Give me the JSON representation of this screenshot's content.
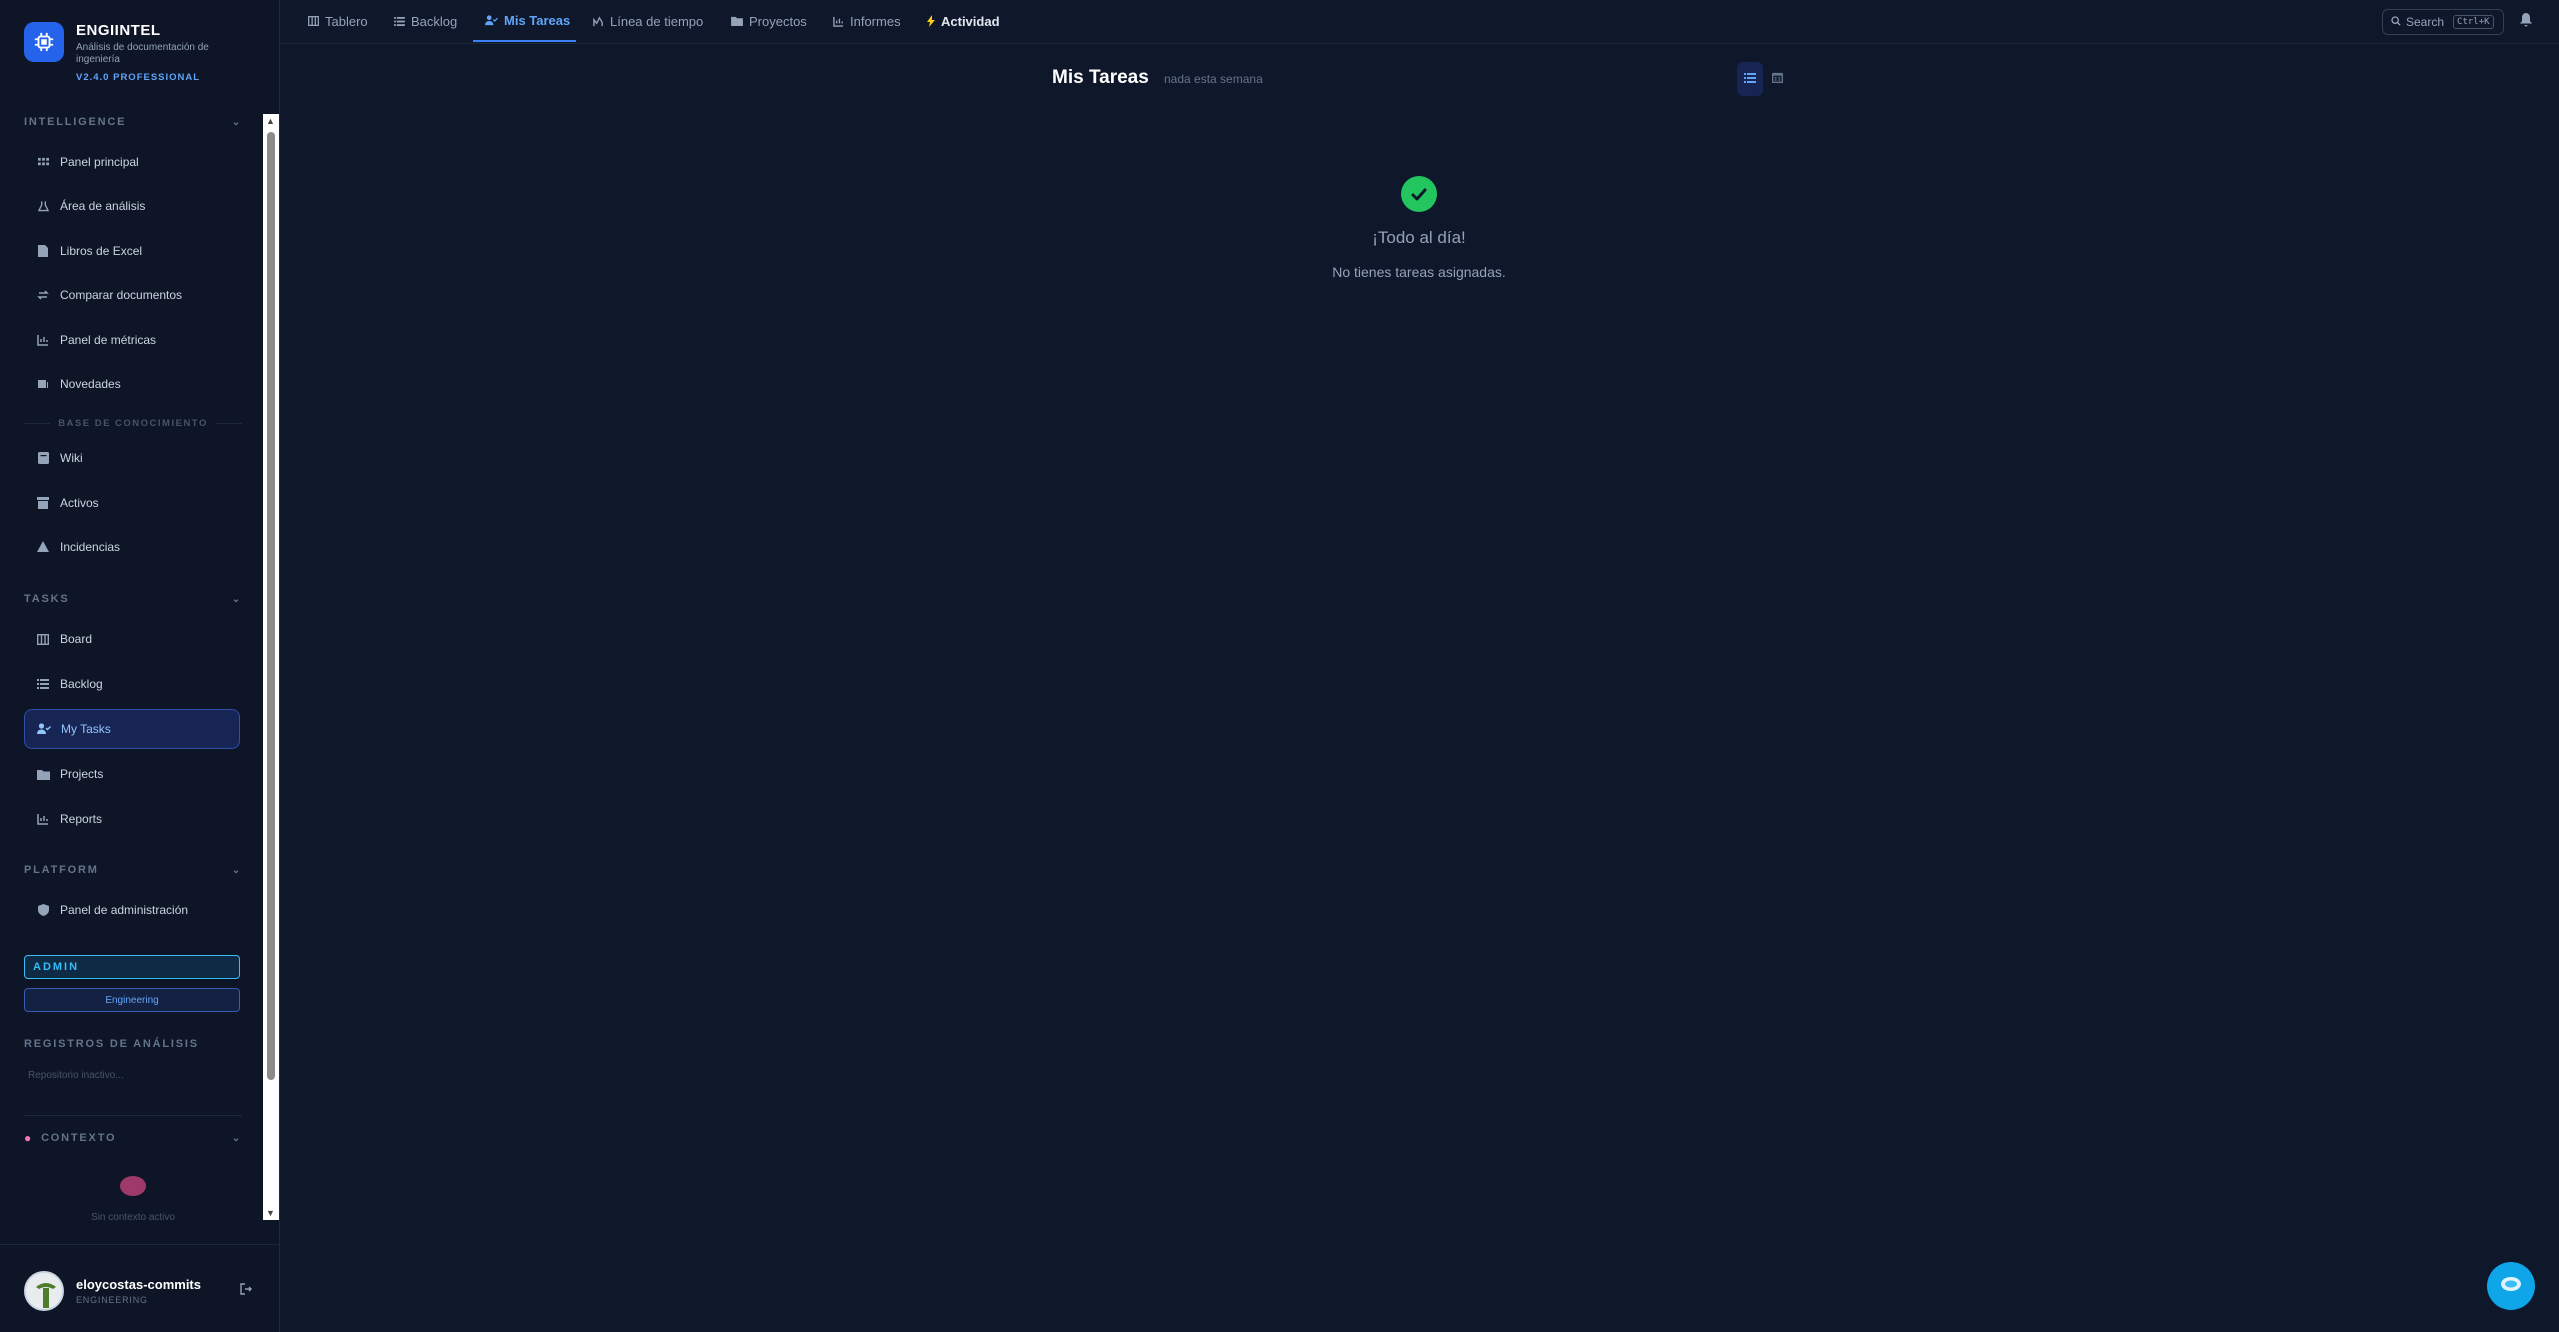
{
  "brand": {
    "title": "ENGIINTEL",
    "subtitle": "Análisis de documentación de ingeniería",
    "version": "V2.4.0 PROFESSIONAL"
  },
  "sidebar": {
    "intelligence_label": "INTELLIGENCE",
    "intelligence_items": [
      {
        "label": "Panel principal",
        "icon": "grid-icon"
      },
      {
        "label": "Área de análisis",
        "icon": "flask-icon"
      },
      {
        "label": "Libros de Excel",
        "icon": "file-icon"
      },
      {
        "label": "Comparar documentos",
        "icon": "compare-icon"
      },
      {
        "label": "Panel de métricas",
        "icon": "chart-icon"
      },
      {
        "label": "Novedades",
        "icon": "news-icon"
      }
    ],
    "knowledge_label": "BASE DE CONOCIMIENTO",
    "knowledge_items": [
      {
        "label": "Wiki",
        "icon": "book-icon"
      },
      {
        "label": "Activos",
        "icon": "archive-icon"
      },
      {
        "label": "Incidencias",
        "icon": "warning-icon"
      }
    ],
    "tasks_label": "TASKS",
    "tasks_items": [
      {
        "label": "Board",
        "icon": "board-icon"
      },
      {
        "label": "Backlog",
        "icon": "list-icon"
      },
      {
        "label": "My Tasks",
        "icon": "user-check-icon",
        "active": true
      },
      {
        "label": "Projects",
        "icon": "folder-icon"
      },
      {
        "label": "Reports",
        "icon": "chart-icon"
      }
    ],
    "platform_label": "PLATFORM",
    "platform_items": [
      {
        "label": "Panel de administración",
        "icon": "shield-icon"
      }
    ],
    "role_badge": "ADMIN",
    "team_badge": "Engineering",
    "logs_label": "REGISTROS DE ANÁLISIS",
    "logs_empty": "Repositorio inactivo...",
    "context_label": "CONTEXTO",
    "context_empty": "Sin contexto activo"
  },
  "user": {
    "name": "eloycostas-commits",
    "role": "ENGINEERING"
  },
  "topnav": {
    "tabs": [
      {
        "label": "Tablero",
        "icon": "board-icon"
      },
      {
        "label": "Backlog",
        "icon": "list-icon"
      },
      {
        "label": "Mis Tareas",
        "icon": "user-check-icon",
        "active": true
      },
      {
        "label": "Línea de tiempo",
        "icon": "timeline-icon"
      },
      {
        "label": "Proyectos",
        "icon": "folder-icon"
      },
      {
        "label": "Informes",
        "icon": "chart-icon"
      },
      {
        "label": "Actividad",
        "icon": "bolt-icon"
      }
    ],
    "search_label": "Search",
    "search_shortcut": "Ctrl+K"
  },
  "main": {
    "title": "Mis Tareas",
    "subtitle": "nada esta semana",
    "empty_title": "¡Todo al día!",
    "empty_message": "No tienes tareas asignadas."
  },
  "colors": {
    "accent": "#3b82f6",
    "success": "#22c55e",
    "background": "#0f172a"
  }
}
